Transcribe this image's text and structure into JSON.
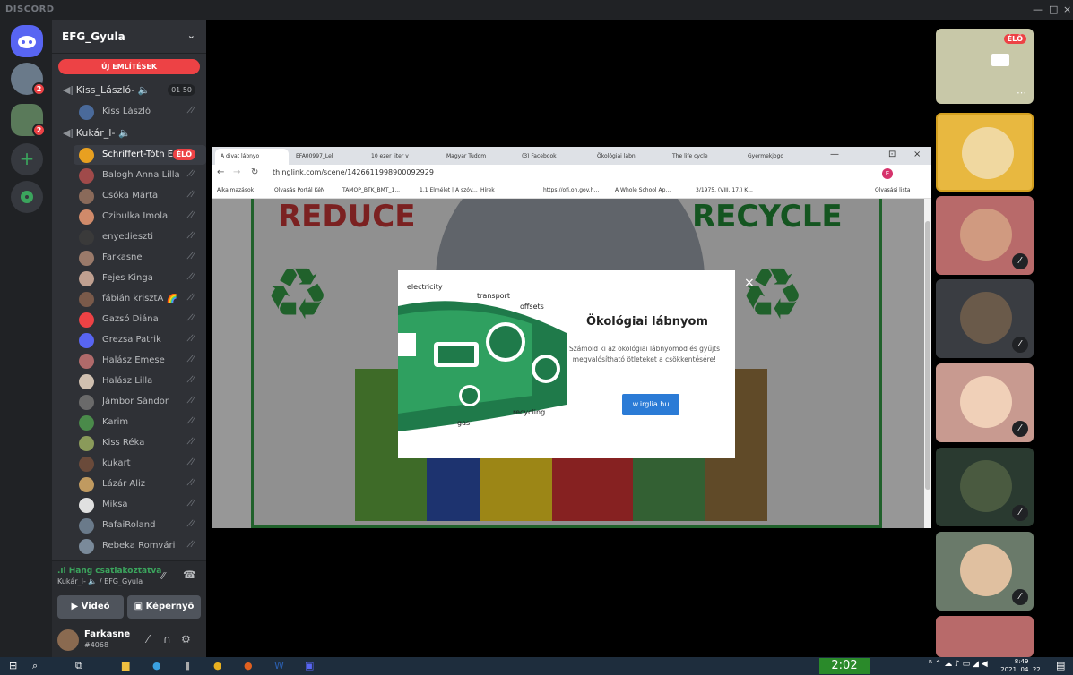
{
  "app": {
    "brand": "DISCORD",
    "min": "—",
    "max": "□",
    "close": "×"
  },
  "servers": [
    {
      "badge": ""
    },
    {
      "badge": "2"
    },
    {
      "badge": "2"
    }
  ],
  "sidebar": {
    "server_name": "EFG_Gyula",
    "mentions": "ÚJ EMLÍTÉSEK",
    "channel1": {
      "name": "Kiss_László- 🔈",
      "count": "01  50"
    },
    "channel1_users": [
      {
        "name": "Kiss László"
      }
    ],
    "channel2": {
      "name": "Kukár_I- 🔈"
    },
    "channel2_users": [
      {
        "name": "Schriffert-Tóth E...",
        "live": "ÉLŐ"
      },
      {
        "name": "Balogh Anna Lilla"
      },
      {
        "name": "Csóka Márta"
      },
      {
        "name": "Czibulka Imola"
      },
      {
        "name": "enyedieszti"
      },
      {
        "name": "Farkasne"
      },
      {
        "name": "Fejes Kinga"
      },
      {
        "name": "fábián krisztA 🌈"
      },
      {
        "name": "Gazsó Diána"
      },
      {
        "name": "Grezsa Patrik"
      },
      {
        "name": "Halász Emese"
      },
      {
        "name": "Halász Lilla"
      },
      {
        "name": "Jámbor Sándor"
      },
      {
        "name": "Karim"
      },
      {
        "name": "Kiss Réka"
      },
      {
        "name": "kukart"
      },
      {
        "name": "Lázár Aliz"
      },
      {
        "name": "Miksa"
      },
      {
        "name": "RafaiRoland"
      },
      {
        "name": "Rebeka Romvári"
      }
    ],
    "voice": {
      "status": ".ıl Hang csatlakoztatva",
      "sub": "Kukár_I- 🔈 / EFG_Gyula",
      "video": "Videó",
      "screen": "Képernyő"
    },
    "me": {
      "name": "Farkasne",
      "tag": "#4068"
    }
  },
  "browser": {
    "tabs": [
      "A divat lábnyo",
      "EFA00997_Lel",
      "10 ezer liter v",
      "Magyar Tudom",
      "(3) Facebook",
      "Ökológiai lábn",
      "The life cycle",
      "Gyermekjogo"
    ],
    "url": "thinglink.com/scene/1426611998900092929",
    "bookmarks": [
      "Alkalmazások",
      "Olvasás Portál KéN",
      "TAMOP_BTK_BMT_1...",
      "1.1 Elmélet | A szóv...",
      "Hírek",
      "https://ofi.oh.gov.h...",
      "A Whole School Ap...",
      "3/1975. (VIII. 17.) K...",
      "Olvasási lista"
    ],
    "page": {
      "reduce": "REDUCE",
      "recycle": "RECYCLE"
    },
    "modal": {
      "title": "Ökológiai lábnyom",
      "desc": "Számold ki az ökológiai lábnyomod és gyűjts megvalósítható ötleteket a csökkentésére!",
      "button": "w.irglia.hu",
      "labels": [
        "electricity",
        "transport",
        "offsets",
        "recycling",
        "gas"
      ]
    }
  },
  "tiles": [
    {
      "live": "ÉLŐ"
    }
  ],
  "taskbar": {
    "timer": "2:02",
    "time": "8:49",
    "date": "2021. 04. 22."
  }
}
